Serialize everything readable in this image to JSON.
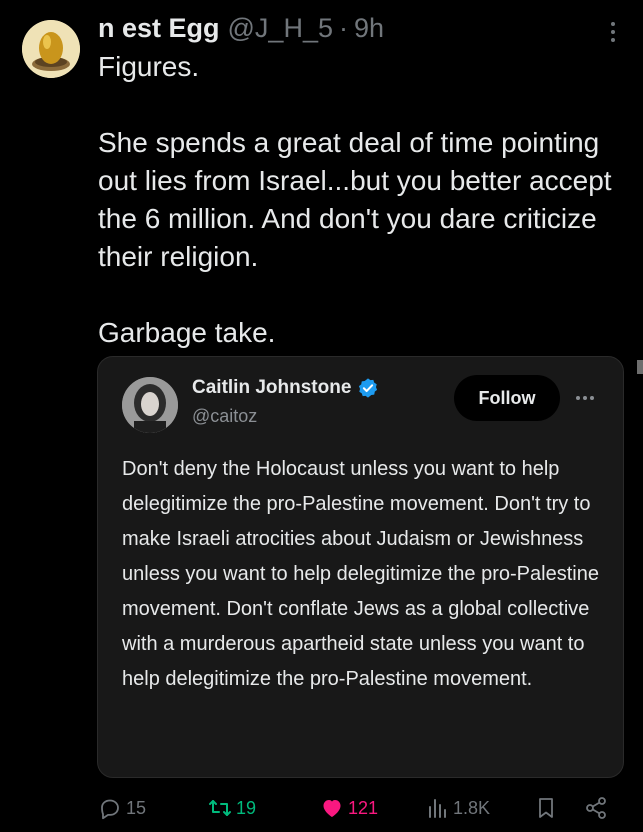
{
  "tweet": {
    "author_name": "n est Egg",
    "author_handle": "@J_H_5",
    "separator": "·",
    "time": "9h",
    "paragraphs": [
      "Figures.",
      "She spends a great deal of time pointing out lies from Israel...but you better accept the 6 million. And don't you dare criticize their religion.",
      "Garbage take."
    ]
  },
  "quote": {
    "author_name": "Caitlin Johnstone",
    "author_handle": "@caitoz",
    "verified": true,
    "follow_label": "Follow",
    "text": "Don't deny the Holocaust unless you want to help delegitimize the pro-Palestine movement. Don't try to make Israeli atrocities about Judaism or Jewishness unless you want to help delegitimize the pro-Palestine movement. Don't conflate Jews as a global collective with a murderous apartheid state unless you want to help delegitimize the pro-Palestine movement."
  },
  "actions": {
    "replies": "15",
    "retweets": "19",
    "likes": "121",
    "views": "1.8K"
  },
  "colors": {
    "background": "#000000",
    "text": "#e7e9ea",
    "muted": "#71767b",
    "retweet_active": "#00ba7c",
    "like_active": "#f91880",
    "verified_badge": "#1d9bf0",
    "quote_card": "#181818"
  },
  "icons": {
    "more": "more-vertical-icon",
    "reply": "reply-icon",
    "retweet": "retweet-icon",
    "like": "heart-icon",
    "views": "views-icon",
    "bookmark": "bookmark-icon",
    "share": "share-icon"
  }
}
